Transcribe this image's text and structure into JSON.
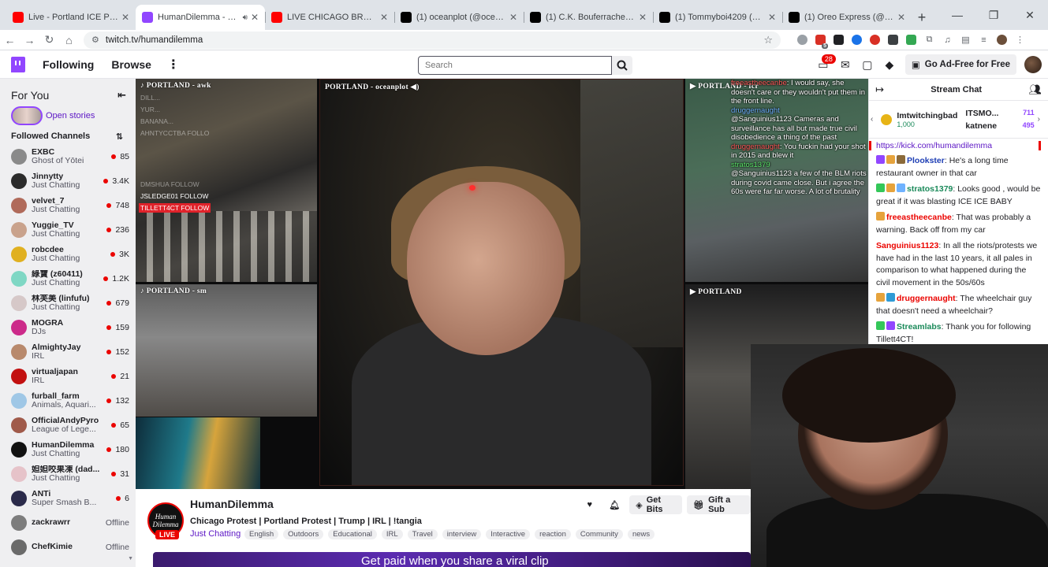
{
  "browser": {
    "tabs": [
      {
        "title": "Live - Portland ICE Protest - Yo",
        "favicon_color": "#ff0000",
        "active": false,
        "audio": false
      },
      {
        "title": "HumanDilemma - Twitch",
        "favicon_color": "#9146ff",
        "active": true,
        "audio": true
      },
      {
        "title": "LIVE CHICAGO BROADVIEW",
        "favicon_color": "#ff0000",
        "active": false,
        "audio": false
      },
      {
        "title": "(1) oceanplot (@oceanplot) / X",
        "favicon_color": "#000000",
        "active": false,
        "audio": false
      },
      {
        "title": "(1) C.K. Bouferrache aka Honey",
        "favicon_color": "#000000",
        "active": false,
        "audio": false
      },
      {
        "title": "(1) Tommyboi4209 (@Tommy4",
        "favicon_color": "#000000",
        "active": false,
        "audio": false
      },
      {
        "title": "(1) Oreo Express (@OreoExpre",
        "favicon_color": "#000000",
        "active": false,
        "audio": false
      }
    ],
    "new_tab": "+",
    "url": "twitch.tv/humandilemma",
    "window_controls": {
      "minimize": "—",
      "maximize": "❐",
      "close": "✕"
    },
    "ext_badge": "5"
  },
  "nav": {
    "following": "Following",
    "browse": "Browse",
    "search_placeholder": "Search",
    "notif_count": "28",
    "ad_free": "Go Ad-Free for Free"
  },
  "sidebar": {
    "title": "For You",
    "stories_label": "Open stories",
    "followed_title": "Followed Channels",
    "channels": [
      {
        "name": "EXBC",
        "game": "Ghost of Yōtei",
        "viewers": "85",
        "live": true,
        "color": "#8a8a8a"
      },
      {
        "name": "Jinnytty",
        "game": "Just Chatting",
        "viewers": "3.4K",
        "live": true,
        "color": "#2b2b2b"
      },
      {
        "name": "velvet_7",
        "game": "Just Chatting",
        "viewers": "748",
        "live": true,
        "color": "#b06a5a"
      },
      {
        "name": "Yuggie_TV",
        "game": "Just Chatting",
        "viewers": "236",
        "live": true,
        "color": "#c9a28c"
      },
      {
        "name": "robcdee",
        "game": "Just Chatting",
        "viewers": "3K",
        "live": true,
        "color": "#e0b020"
      },
      {
        "name": "綠寶 (z60411)",
        "game": "Just Chatting",
        "viewers": "1.2K",
        "live": true,
        "color": "#7fd7c4"
      },
      {
        "name": "林芙美 (linfufu)",
        "game": "Just Chatting",
        "viewers": "679",
        "live": true,
        "color": "#d6c8c8"
      },
      {
        "name": "MOGRA",
        "game": "DJs",
        "viewers": "159",
        "live": true,
        "color": "#cc2a8a"
      },
      {
        "name": "AlmightyJay",
        "game": "IRL",
        "viewers": "152",
        "live": true,
        "color": "#b8896c"
      },
      {
        "name": "virtualjapan",
        "game": "IRL",
        "viewers": "21",
        "live": true,
        "color": "#c21010"
      },
      {
        "name": "furball_farm",
        "game": "Animals, Aquari...",
        "viewers": "132",
        "live": true,
        "color": "#9fc7e6"
      },
      {
        "name": "OfficialAndyPyro",
        "game": "League of Lege...",
        "viewers": "65",
        "live": true,
        "color": "#a05a4a"
      },
      {
        "name": "HumanDilemma",
        "game": "Just Chatting",
        "viewers": "180",
        "live": true,
        "color": "#111111"
      },
      {
        "name": "妲妲咬果凍 (dad...",
        "game": "Just Chatting",
        "viewers": "31",
        "live": true,
        "color": "#e6c3c9"
      },
      {
        "name": "ANTi",
        "game": "Super Smash B...",
        "viewers": "6",
        "live": true,
        "color": "#2a2a4a"
      },
      {
        "name": "zackrawrr",
        "game": "",
        "viewers": "Offline",
        "live": false,
        "color": "#7d7d7d"
      },
      {
        "name": "ChefKimie",
        "game": "",
        "viewers": "Offline",
        "live": false,
        "color": "#6a6a6a"
      }
    ]
  },
  "video": {
    "panes": {
      "p1": "PORTLAND - awk",
      "p2": "PORTLAND - sm",
      "p4": "PORTLAND - oceanplot",
      "p5": "PORTLAND - fcr",
      "p6": "PORTLAND"
    },
    "p1_follows": [
      {
        "text": "DILL...",
        "style": "ghost"
      },
      {
        "text": "YUR...",
        "style": "ghost"
      },
      {
        "text": "BANANA...",
        "style": "ghost"
      },
      {
        "text": "AHNTYCCTBA  FOLLO",
        "style": "ghost"
      },
      {
        "text": "DMSHUA  FOLLOW",
        "style": "ghost"
      },
      {
        "text": "JSLEDGE01  FOLLOW",
        "style": "plain"
      },
      {
        "text": "TILLETT4CT  FOLLOW",
        "style": "red"
      }
    ],
    "overlay_chat": [
      {
        "user": "freeastheecanbe",
        "user_color": "u",
        "text": ": I would say, she doesn't care or they wouldn't put them in the front line."
      },
      {
        "user": "druggernaught",
        "user_color": "b",
        "text": ""
      },
      {
        "user": "",
        "user_color": "u",
        "text": "@Sanguinius1123 Cameras and surveillance has all but made true civil disobedience a thing of the past"
      },
      {
        "user": "druggernaught",
        "user_color": "u",
        "text": ": You fuckin had your shot in 2015 and blew it"
      },
      {
        "user": "stratos1379",
        "user_color": "g",
        "text": ""
      },
      {
        "user": "",
        "user_color": "u",
        "text": "@Sanguinius1123 a few of the BLM riots during covid came close. But i agree the 60s were far far worse. A lot of brutality"
      }
    ]
  },
  "channel": {
    "name": "HumanDilemma",
    "avatar_text": "Human Dilemma",
    "live": "LIVE",
    "title": "Chicago Protest | Portland Protest | Trump | IRL | !tangia",
    "category": "Just Chatting",
    "tags": [
      "English",
      "Outdoors",
      "Educational",
      "IRL",
      "Travel",
      "interview",
      "Interactive",
      "reaction",
      "Community",
      "news"
    ],
    "get_bits": "Get Bits",
    "gift_sub": "Gift a Sub",
    "promo": "Get paid when you share a viral clip"
  },
  "chat": {
    "title": "Stream Chat",
    "leaderboard": {
      "first": {
        "name": "Imtwitchingbad",
        "points": "1,000"
      },
      "others": [
        {
          "name": "ITSMO...",
          "points": "711"
        },
        {
          "name": "katnene",
          "points": "495"
        }
      ]
    },
    "link": "https://kick.com/humandilemma",
    "messages": [
      {
        "user": "Plookster",
        "color": "#1e3eb4",
        "badges": [
          "#9146ff",
          "#e6a33c",
          "#8b6a3a"
        ],
        "text": ": He's a long time restaurant owner in that car"
      },
      {
        "user": "stratos1379",
        "color": "#1b8a5a",
        "badges": [
          "#34c759",
          "#e6a33c",
          "#6fb2ff"
        ],
        "text": ": Looks good , would be great if it was blasting ICE ICE BABY"
      },
      {
        "user": "freeastheecanbe",
        "color": "#eb0400",
        "badges": [
          "#e6a33c"
        ],
        "text": ": That was probably a warning. Back off from my car"
      },
      {
        "user": "Sanguinius1123",
        "color": "#eb0400",
        "badges": [],
        "text": ": In all the riots/protests we have had in the last 10 years, it all pales in comparison to what happened during the civil movement in the 50s/60s"
      },
      {
        "user": "druggernaught",
        "color": "#eb0400",
        "badges": [
          "#e6a33c",
          "#2f9bd6"
        ],
        "text": ": The wheelchair guy that doesn't need a wheelchair?"
      },
      {
        "user": "Streamlabs",
        "color": "#1b8a5a",
        "badges": [
          "#34c759",
          "#9146ff"
        ],
        "text": ": Thank you for following Tillett4CT!"
      }
    ]
  }
}
